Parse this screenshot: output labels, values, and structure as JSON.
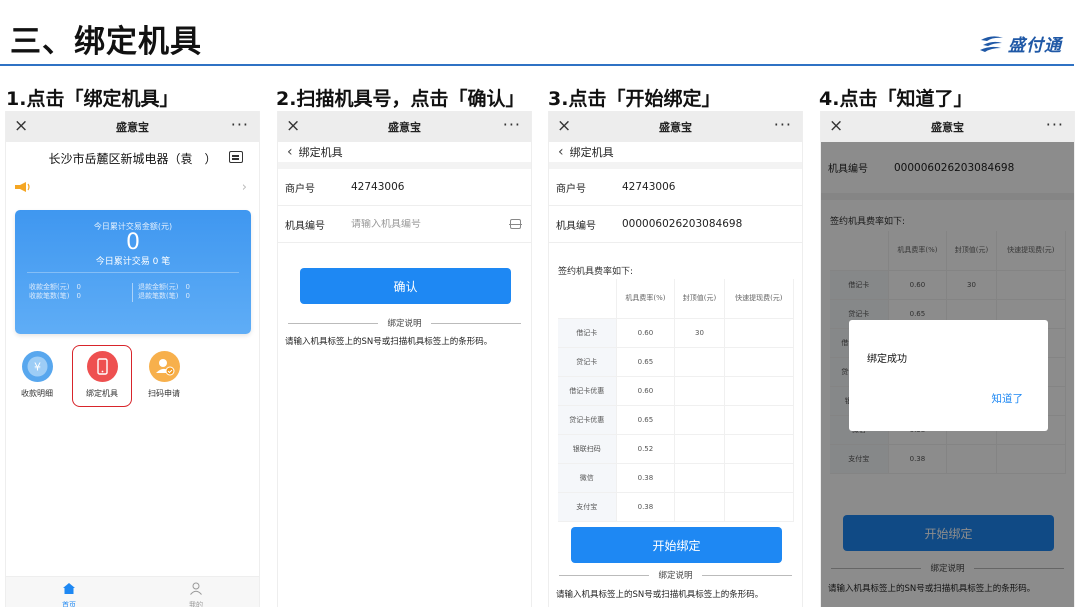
{
  "slide": {
    "title": "三、绑定机具",
    "brand": "盛付通"
  },
  "steps": [
    "1.点击「绑定机具」",
    "2.扫描机具号，点击「确认」",
    "3.点击「开始绑定」",
    "4.点击「知道了」"
  ],
  "app": {
    "title": "盛意宝",
    "close": "×",
    "more": "···"
  },
  "home": {
    "store": "长沙市岳麓区新城电器（袁　）",
    "card": {
      "amount_label": "今日累计交易金额(元)",
      "amount": "0",
      "count_label": "今日累计交易 0 笔",
      "left_stats": [
        "收款金额(元)　0",
        "收款笔数(笔)　0"
      ],
      "right_stats": [
        "退款金额(元)　0",
        "退款笔数(笔)　0"
      ]
    },
    "functions": [
      "收款明细",
      "绑定机具",
      "扫码申请"
    ],
    "tabs": [
      "首页",
      "我的"
    ]
  },
  "bind": {
    "header": "绑定机具",
    "merchant_label": "商户号",
    "merchant_no": "42743006",
    "device_label": "机具编号",
    "device_placeholder": "请输入机具编号",
    "device_no": "000006026203084698",
    "confirm": "确认",
    "explain_title": "绑定说明",
    "explain_body": "请输入机具标签上的SN号或扫描机具标签上的条形码。",
    "rate_caption": "签约机具费率如下:",
    "rate_headers": [
      "",
      "机具费率(%)",
      "封顶值(元)",
      "快速提现费(元)"
    ],
    "rates": [
      [
        "借记卡",
        "0.60",
        "30",
        ""
      ],
      [
        "贷记卡",
        "0.65",
        "",
        ""
      ],
      [
        "借记卡优惠",
        "0.60",
        "",
        ""
      ],
      [
        "贷记卡优惠",
        "0.65",
        "",
        ""
      ],
      [
        "银联扫码",
        "0.52",
        "",
        ""
      ],
      [
        "微信",
        "0.38",
        "",
        ""
      ],
      [
        "支付宝",
        "0.38",
        "",
        ""
      ]
    ],
    "start": "开始绑定"
  },
  "dialog": {
    "message": "绑定成功",
    "button": "知道了"
  },
  "colors": {
    "primary": "#1e88f3",
    "title_rule": "#2f72c4",
    "highlight": "#d8252b",
    "brand": "#1f58a6"
  }
}
